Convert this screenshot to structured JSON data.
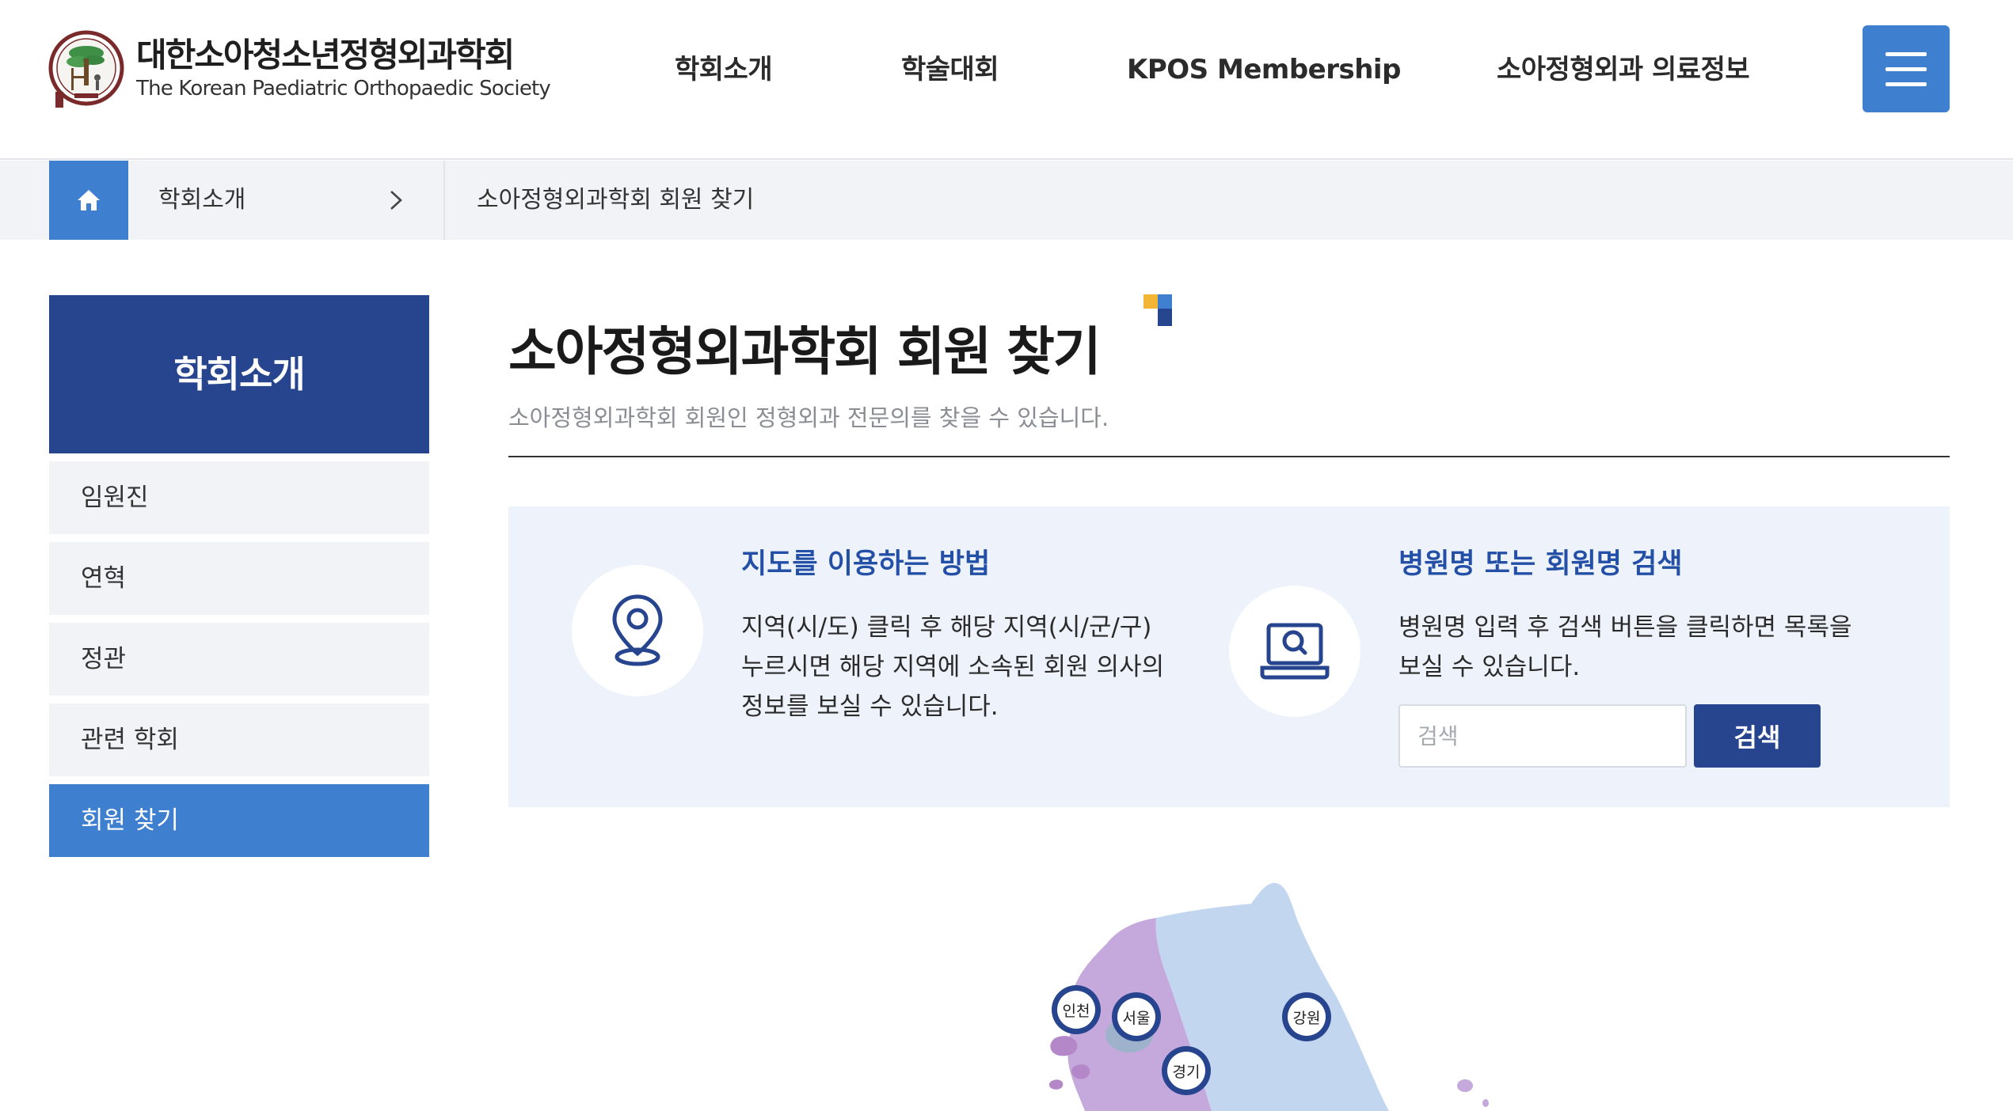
{
  "header": {
    "logo": {
      "name_ko": "대한소아청소년정형외과학회",
      "name_en": "The Korean Paediatric Orthopaedic Society"
    },
    "nav": [
      {
        "label": "학회소개"
      },
      {
        "label": "학술대회"
      },
      {
        "label": "KPOS Membership"
      },
      {
        "label": "소아정형외과 의료정보"
      }
    ],
    "menu_button_icon": "hamburger-icon"
  },
  "breadcrumb": {
    "home_icon": "home-icon",
    "first": "학회소개",
    "current": "소아정형외과학회 회원 찾기"
  },
  "sidebar": {
    "title": "학회소개",
    "items": [
      {
        "label": "임원진",
        "active": false
      },
      {
        "label": "연혁",
        "active": false
      },
      {
        "label": "정관",
        "active": false
      },
      {
        "label": "관련 학회",
        "active": false
      },
      {
        "label": "회원 찾기",
        "active": true
      }
    ]
  },
  "main": {
    "title": "소아정형외과학회 회원 찾기",
    "subtitle": "소아정형외과학회 회원인 정형외과 전문의를 찾을 수 있습니다.",
    "map_guide": {
      "icon": "location-pin-icon",
      "title": "지도를 이용하는 방법",
      "lines": [
        "지역(시/도) 클릭 후 해당 지역(시/군/구)",
        "누르시면 해당 지역에 소속된 회원 의사의",
        "정보를 보실 수 있습니다."
      ]
    },
    "search_guide": {
      "icon": "laptop-search-icon",
      "title": "병원명 또는 회원명 검색",
      "lines": [
        "병원명 입력 후 검색 버튼을 클릭하면 목록을",
        "보실 수 있습니다."
      ],
      "input_value": "",
      "input_placeholder": "검색",
      "button_label": "검색"
    },
    "map": {
      "regions": [
        "인천",
        "서울",
        "경기",
        "강원"
      ]
    }
  },
  "colors": {
    "primary_blue": "#3f7fd0",
    "navy": "#27448f",
    "title_blue": "#2350a6",
    "light_panel": "#eef3fb",
    "gyeonggi_purple": "#c5a8dc",
    "gangwon_blue": "#c3d6ef"
  }
}
